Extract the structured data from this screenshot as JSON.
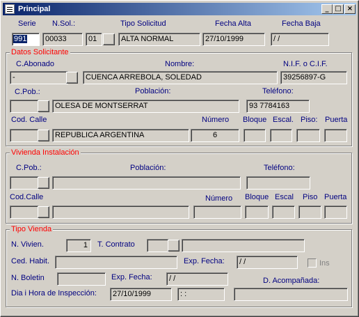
{
  "window": {
    "title": "Principal",
    "minimize": "_",
    "maximize": "□",
    "close": "×"
  },
  "top": {
    "serie_label": "Serie",
    "nsol_label": "N.Sol.:",
    "tipo_label": "Tipo Solicitud",
    "fecha_alta_label": "Fecha  Alta",
    "fecha_baja_label": "Fecha Baja",
    "serie_value": "991",
    "nsol_value": "00033",
    "tipo_code": "01",
    "tipo_value": "ALTA NORMAL",
    "fecha_alta_value": "27/10/1999",
    "fecha_baja_value": " / /"
  },
  "solicitante": {
    "title": "Datos Solicitante",
    "cabonado_label": "C.Abonado",
    "nombre_label": "Nombre:",
    "nif_label": "N.I.F. o C.I.F.",
    "cabonado_value": "-",
    "nombre_value": "CUENCA ARREBOLA, SOLEDAD",
    "nif_value": "39256897-G",
    "cpob_label": "C.Pob.:",
    "poblacion_label": "Población:",
    "telefono_label": "Teléfono:",
    "cpob_value": "",
    "poblacion_value": "OLESA DE MONTSERRAT",
    "telefono_value": "93 7784163",
    "codcalle_label": "Cod. Calle",
    "numero_label": "Número",
    "bloque_label": "Bloque",
    "escal_label": "Escal.",
    "piso_label": "Piso:",
    "puerta_label": "Puerta",
    "calle_value": "REPUBLICA ARGENTINA",
    "numero_value": "6",
    "bloque_value": "",
    "escal_value": "",
    "piso_value": "",
    "puerta_value": ""
  },
  "vivienda": {
    "title": "Vivienda Instalación",
    "cpob_label": "C.Pob.:",
    "poblacion_label": "Población:",
    "telefono_label": "Teléfono:",
    "codcalle_label": "Cod.Calle",
    "numero_label": "Número",
    "bloque_label": "Bloque",
    "escal_label": "Escal",
    "piso_label": "Piso",
    "puerta_label": "Puerta"
  },
  "tipo_vienda": {
    "title": "Tipo Vienda",
    "nvivien_label": "N. Vivien.",
    "nvivien_value": "1",
    "tcontrato_label": "T. Contrato",
    "cedhabit_label": "Ced. Habit.",
    "expfecha1_label": "Exp. Fecha:",
    "expfecha1_value": " / /",
    "ins_label": "Ins",
    "nboletin_label": "N. Boletin",
    "expfecha2_label": "Exp. Fecha:",
    "expfecha2_value": " / /",
    "acompanada_label": "D.  Acompañada:",
    "inspeccion_label": "Dia i Hora de Inspección:",
    "inspeccion_date": "27/10/1999",
    "inspeccion_time": " :  :"
  }
}
